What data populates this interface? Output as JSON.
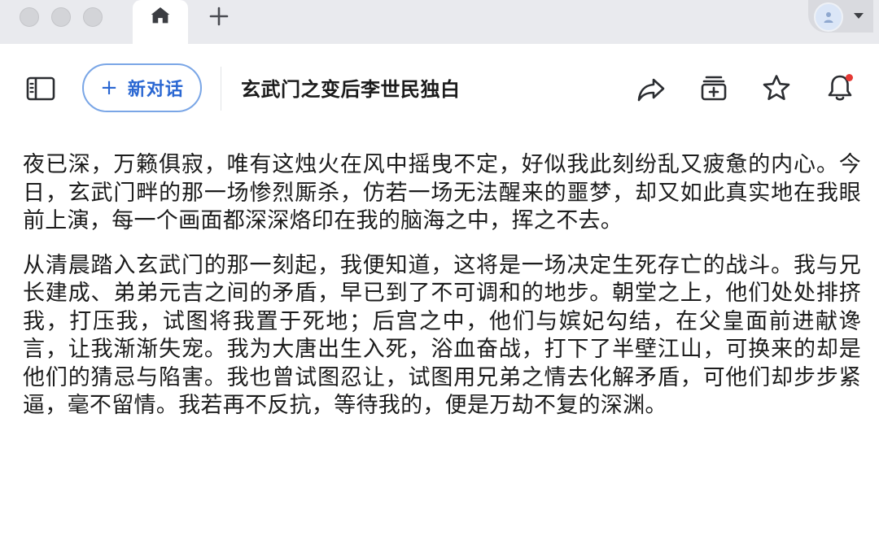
{
  "window": {
    "tabs": [
      {
        "icon": "home-icon",
        "active": true
      },
      {
        "icon": "plus-icon",
        "active": false
      }
    ],
    "profile": {
      "icon": "person-icon"
    }
  },
  "toolbar": {
    "new_chat_label": "新对话",
    "title": "玄武门之变后李世民独白",
    "icons": [
      "sidebar-toggle-icon",
      "share-icon",
      "add-to-folder-icon",
      "star-icon",
      "bell-icon"
    ],
    "colors": {
      "accent": "#2a67d2",
      "accent_border": "#7aa6e6",
      "notification": "#e53935"
    }
  },
  "content": {
    "paragraphs": [
      "夜已深，万籁俱寂，唯有这烛火在风中摇曳不定，好似我此刻纷乱又疲惫的内心。今日，玄武门畔的那一场惨烈厮杀，仿若一场无法醒来的噩梦，却又如此真实地在我眼前上演，每一个画面都深深烙印在我的脑海之中，挥之不去。",
      "从清晨踏入玄武门的那一刻起，我便知道，这将是一场决定生死存亡的战斗。我与兄长建成、弟弟元吉之间的矛盾，早已到了不可调和的地步。朝堂之上，他们处处排挤我，打压我，试图将我置于死地；后宫之中，他们与嫔妃勾结，在父皇面前进献谗言，让我渐渐失宠。我为大唐出生入死，浴血奋战，打下了半壁江山，可换来的却是他们的猜忌与陷害。我也曾试图忍让，试图用兄弟之情去化解矛盾，可他们却步步紧逼，毫不留情。我若再不反抗，等待我的，便是万劫不复的深渊。"
    ]
  }
}
